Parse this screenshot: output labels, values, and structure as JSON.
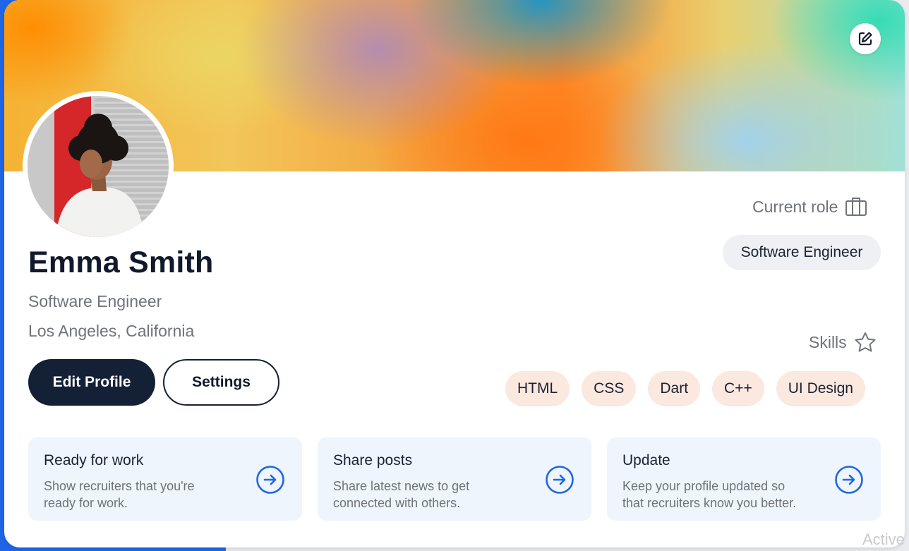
{
  "profile": {
    "name": "Emma Smith",
    "title": "Software Engineer",
    "location": "Los Angeles, California"
  },
  "actions": {
    "edit_label": "Edit Profile",
    "settings_label": "Settings"
  },
  "current_role": {
    "label": "Current role",
    "value": "Software Engineer",
    "icon": "briefcase-icon"
  },
  "skills": {
    "label": "Skills",
    "icon": "star-icon",
    "items": [
      "HTML",
      "CSS",
      "Dart",
      "C++",
      "UI Design"
    ]
  },
  "tiles": [
    {
      "title": "Ready for work",
      "desc_line1": "Show recruiters that you're",
      "desc_line2": "ready for work."
    },
    {
      "title": "Share posts",
      "desc_line1": "Share latest news to get",
      "desc_line2": "connected with others."
    },
    {
      "title": "Update",
      "desc_line1": "Keep your profile updated so",
      "desc_line2": "that recruiters know you better."
    }
  ],
  "watermark": "Active",
  "colors": {
    "primary_dark": "#142035",
    "accent_blue": "#1f66e6",
    "chip_grey": "#eef0f3",
    "skill_chip": "#fbe8df",
    "tile_bg": "#eff5fc"
  }
}
